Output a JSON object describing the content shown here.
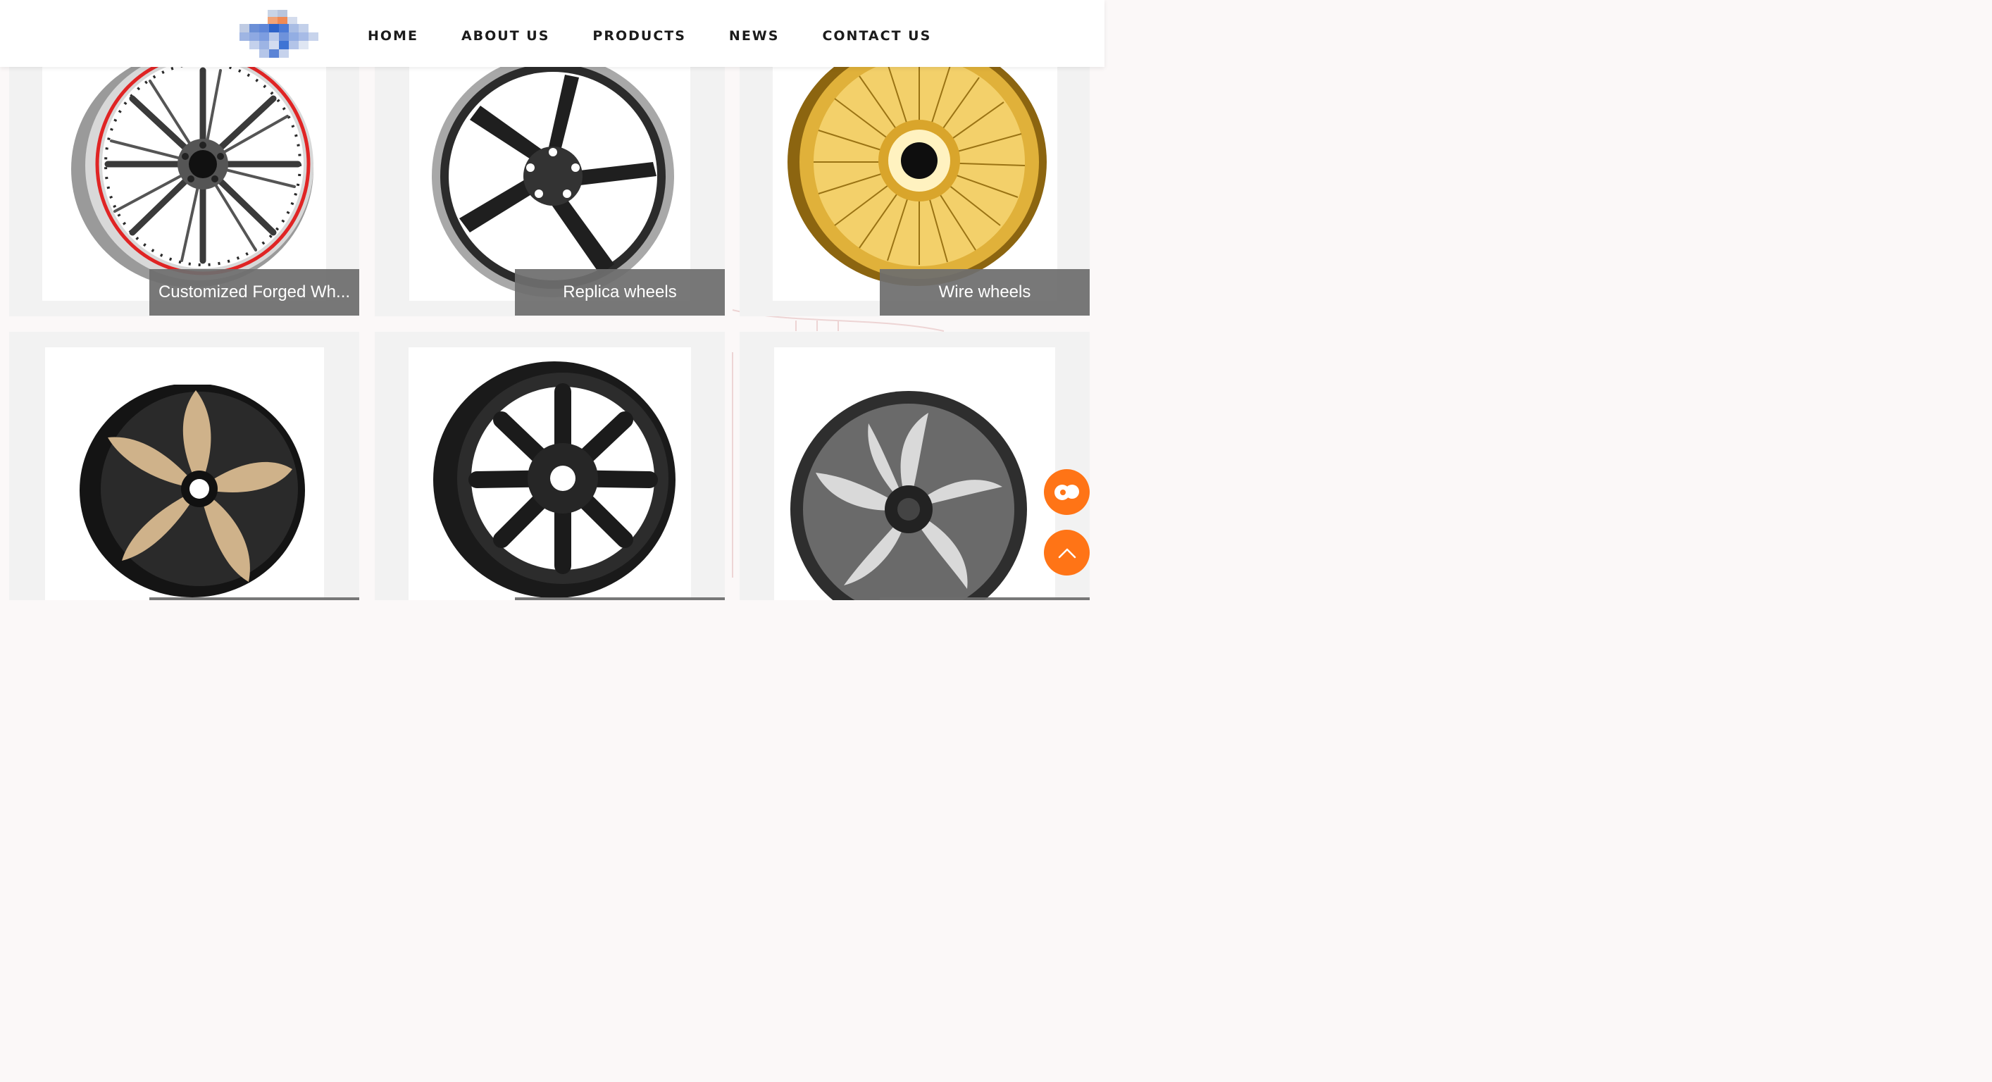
{
  "header": {
    "logo_icon": "company-logo-pixelated",
    "nav": [
      {
        "label": "HOME"
      },
      {
        "label": "ABOUT US"
      },
      {
        "label": "PRODUCTS"
      },
      {
        "label": "NEWS"
      },
      {
        "label": "CONTACT US"
      }
    ]
  },
  "products": [
    {
      "caption": "Customized Forged Wh...",
      "icon": "multi-spoke-forged-wheel"
    },
    {
      "caption": "Replica wheels",
      "icon": "five-spoke-replica-wheel"
    },
    {
      "caption": "Wire wheels",
      "icon": "gold-wire-wheel"
    },
    {
      "caption": "",
      "icon": "gold-black-alloy-wheel"
    },
    {
      "caption": "",
      "icon": "black-offroad-wheel"
    },
    {
      "caption": "",
      "icon": "swirl-spoke-wheel"
    }
  ],
  "floating": {
    "chat_icon": "chat-bubble-icon",
    "top_icon": "chevron-up-icon"
  },
  "colors": {
    "accent": "#ff7416",
    "caption_bg": "#6e6e6e",
    "card_bg": "#f2f2f2",
    "gold": "#d6a52c"
  }
}
